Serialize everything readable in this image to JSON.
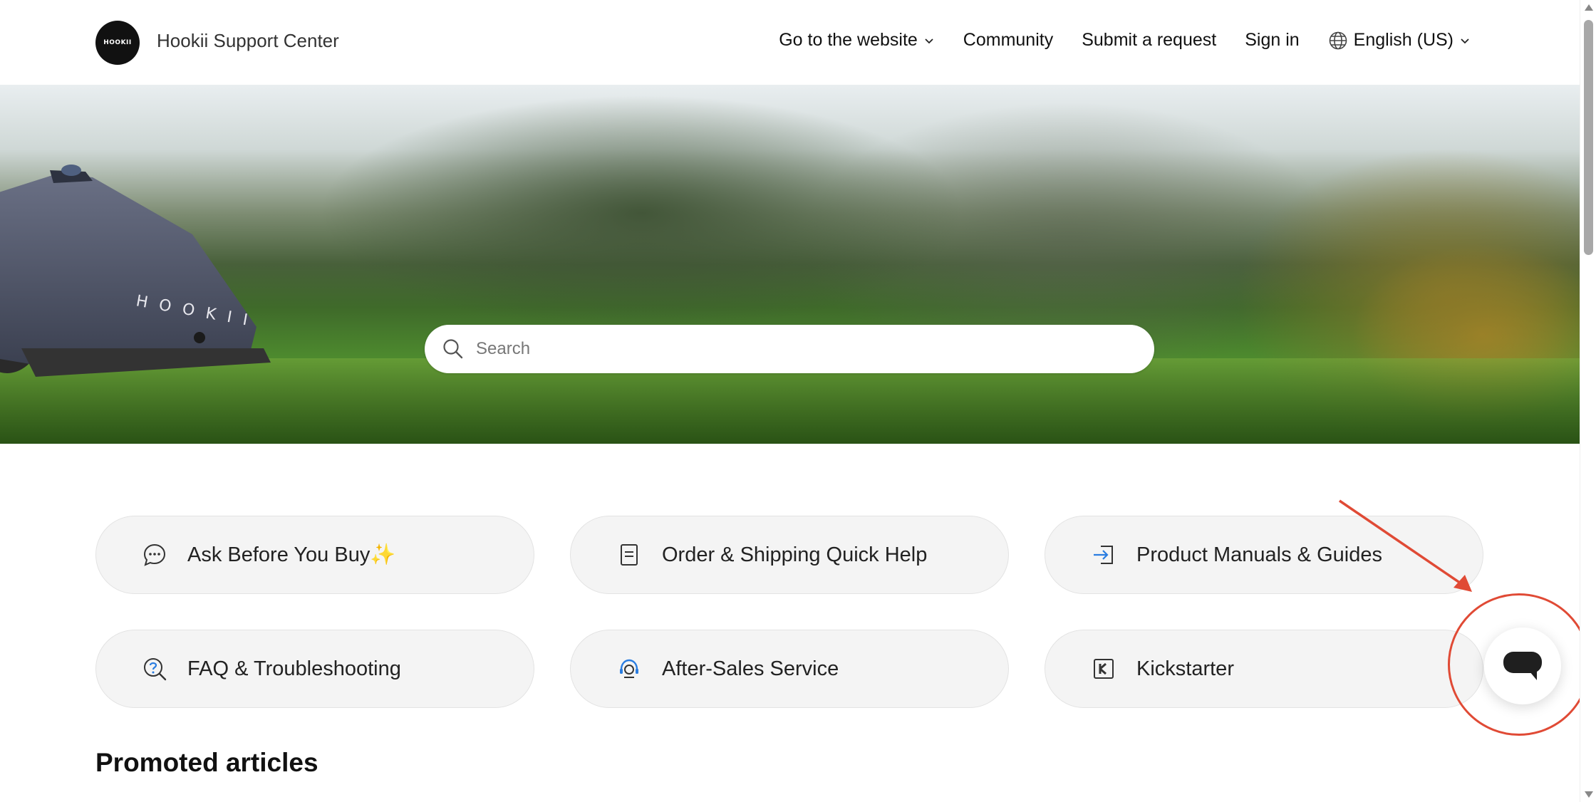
{
  "header": {
    "logo_text": "HOOKII",
    "brand": "Hookii Support Center",
    "nav": {
      "website": "Go to the website",
      "community": "Community",
      "submit": "Submit a request",
      "signin": "Sign in",
      "language": "English (US)"
    }
  },
  "hero": {
    "mower_text": "HOOKII",
    "search_placeholder": "Search"
  },
  "categories": [
    {
      "label": "Ask Before You Buy✨",
      "icon": "chat-bubble-icon"
    },
    {
      "label": "Order & Shipping Quick Help",
      "icon": "document-icon"
    },
    {
      "label": "Product Manuals & Guides",
      "icon": "sign-in-arrow-icon"
    },
    {
      "label": "FAQ & Troubleshooting",
      "icon": "question-search-icon"
    },
    {
      "label": "After-Sales Service",
      "icon": "headset-icon"
    },
    {
      "label": "Kickstarter",
      "icon": "kickstarter-icon"
    }
  ],
  "sections": {
    "promoted": "Promoted articles"
  },
  "colors": {
    "annotation": "#e04a35",
    "card_bg": "#f4f4f4",
    "accent_blue": "#2a7de1"
  }
}
